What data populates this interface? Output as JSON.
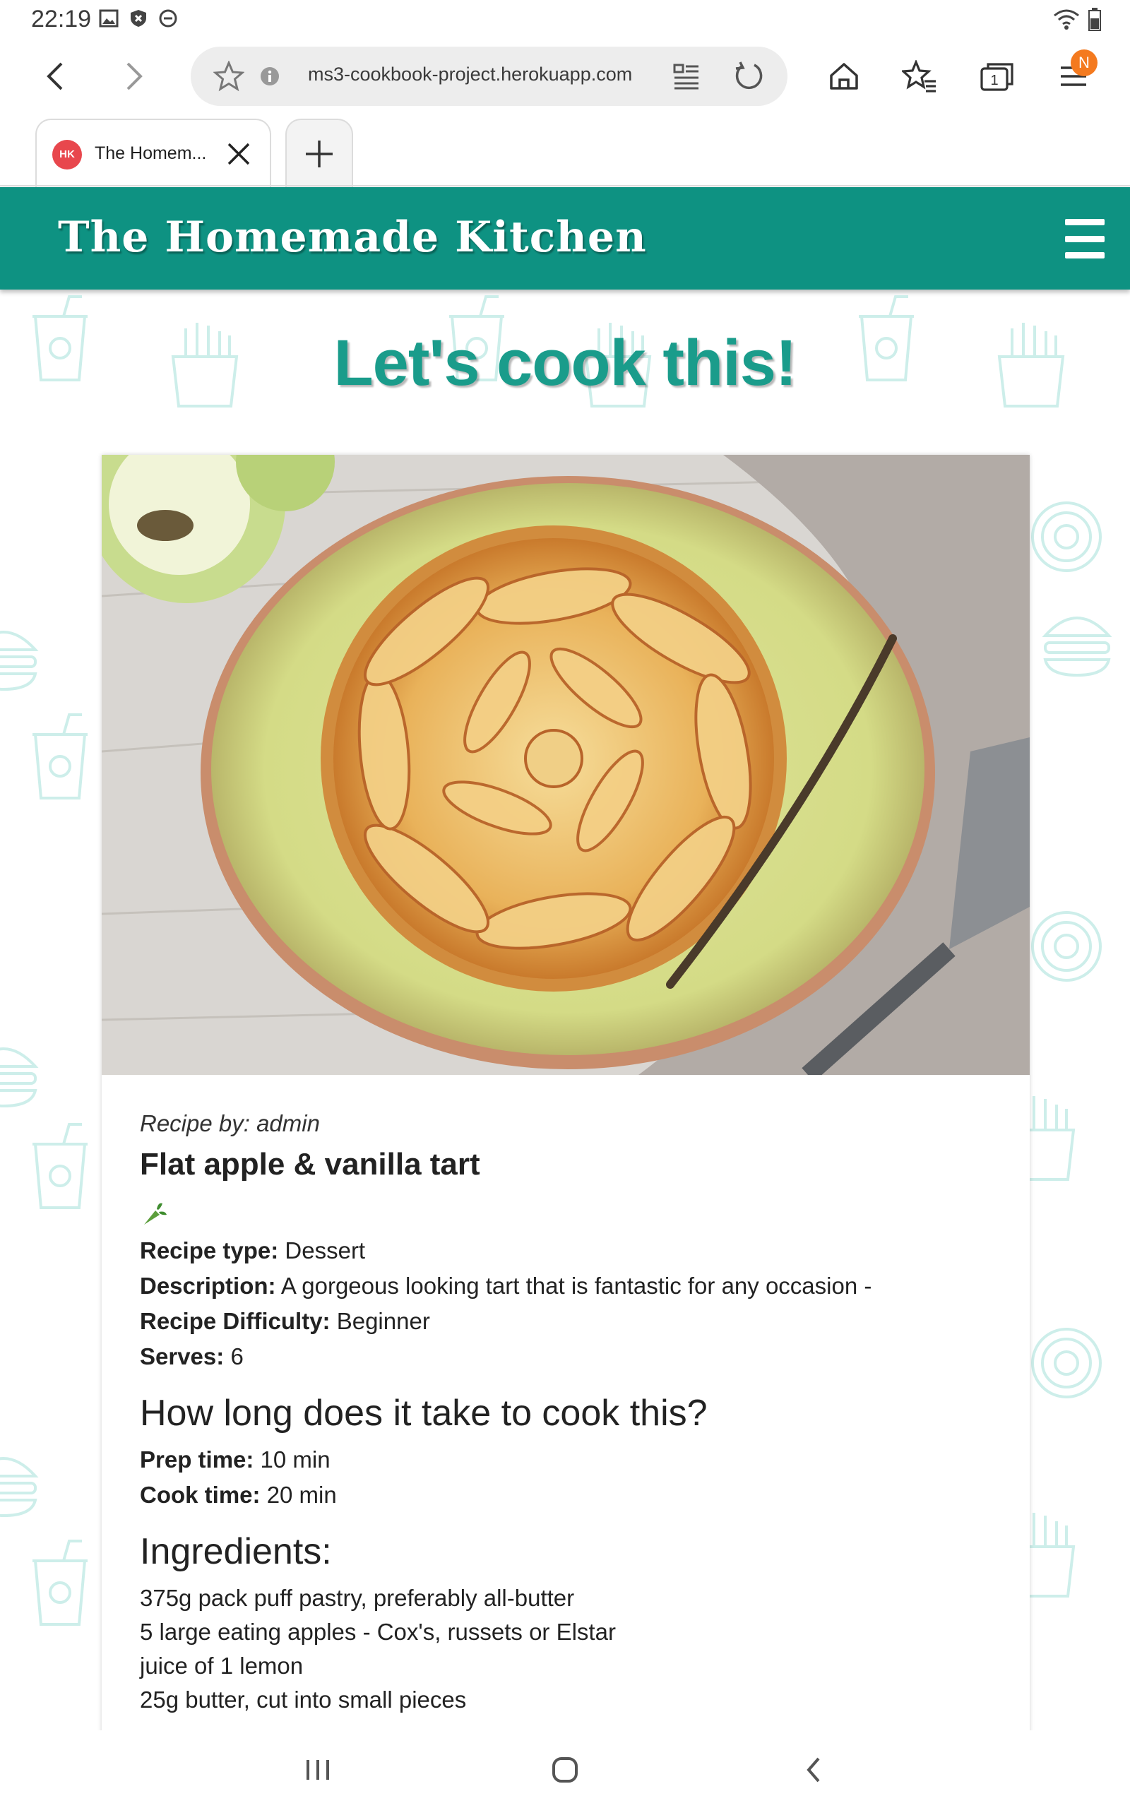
{
  "status_bar": {
    "time": "22:19"
  },
  "browser": {
    "url": "ms3-cookbook-project.herokuapp.com",
    "tab_title": "The Homem...",
    "tab_favicon_text": "HK",
    "notification_badge": "N",
    "tab_count": "1",
    "icons": [
      "back-icon",
      "forward-icon",
      "star-icon",
      "info-icon",
      "reader-icon",
      "reload-icon",
      "home-icon",
      "bookmarks-icon",
      "tabs-icon",
      "menu-icon",
      "close-icon",
      "plus-icon"
    ]
  },
  "site": {
    "brand": "The Homemade Kitchen",
    "heading": "Let's cook this!",
    "colors": {
      "header": "#0e9282",
      "heading": "#1a9c8b"
    }
  },
  "recipe": {
    "recipe_by": "Recipe by: admin",
    "title": "Flat apple & vanilla tart",
    "type_label": "Recipe type:",
    "type_value": "Dessert",
    "description_label": "Description:",
    "description_value": "A gorgeous looking tart that is fantastic for any occasion -",
    "difficulty_label": "Recipe Difficulty:",
    "difficulty_value": "Beginner",
    "serves_label": "Serves:",
    "serves_value": "6",
    "time_heading": "How long does it take to cook this?",
    "prep_label": "Prep time:",
    "prep_value": "10 min",
    "cook_label": "Cook time:",
    "cook_value": "20 min",
    "ingredients_heading": "Ingredients:",
    "ingredients": [
      "375g pack puff pastry, preferably all-butter",
      "5 large eating apples - Cox's, russets or Elstar",
      "juice of 1 lemon",
      "25g butter, cut into small pieces"
    ]
  }
}
